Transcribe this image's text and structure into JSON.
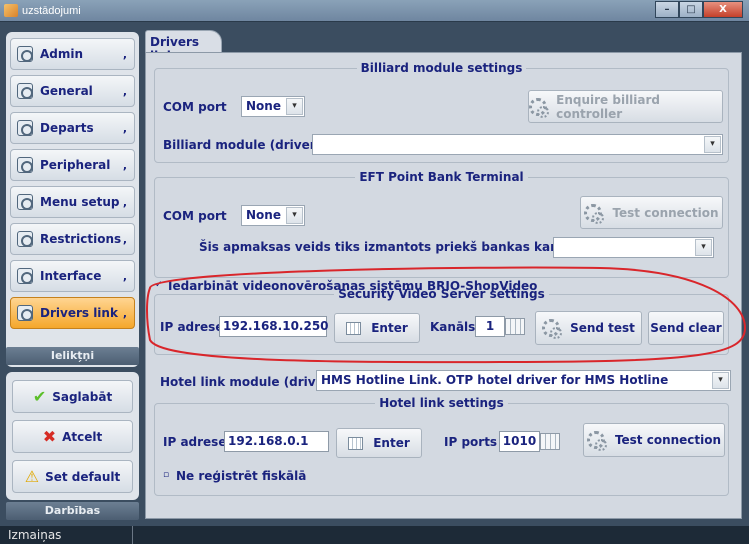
{
  "window": {
    "title": "uzstādojumi",
    "min": "–",
    "max": "□",
    "close": "X"
  },
  "sidebar": {
    "items": [
      {
        "label": "Admin",
        "arrow": ","
      },
      {
        "label": "General",
        "arrow": ","
      },
      {
        "label": "Departs",
        "arrow": ","
      },
      {
        "label": "Peripheral",
        "arrow": ","
      },
      {
        "label": "Menu setup",
        "arrow": ","
      },
      {
        "label": "Restrictions",
        "arrow": ","
      },
      {
        "label": "Interface",
        "arrow": ","
      },
      {
        "label": "Drivers link",
        "arrow": ","
      }
    ],
    "section_settings": "Ielikt̗ņi",
    "actions": [
      {
        "label": "Saglabāt",
        "icon": "check-icon"
      },
      {
        "label": "Atcelt",
        "icon": "cross-icon"
      },
      {
        "label": "Set default",
        "icon": "warning-icon"
      }
    ],
    "section_actions": "Darbības"
  },
  "status": {
    "text": "Izmaiņas"
  },
  "tab": {
    "label": "Drivers link"
  },
  "billiard": {
    "legend": "Billiard module settings",
    "com_label": "COM port",
    "com_value": "None",
    "enquire_button": "Enquire billiard controller",
    "driver_label": "Billiard module (driver)",
    "driver_value": ""
  },
  "eft": {
    "legend": "EFT Point Bank Terminal",
    "com_label": "COM port",
    "com_value": "None",
    "test_button": "Test connection",
    "card_label": "Šis apmaksas veids tiks izmantots priekš bankas kartēm",
    "card_value": ""
  },
  "video": {
    "enable_label": "Iedarbināt videonovērošanas sistēmu BRIO-ShopVideo",
    "enable_checked": "✓",
    "legend": "Security Video Server settings",
    "ip_label": "IP adrese",
    "ip_value": "192.168.10.250",
    "enter_button": "Enter",
    "channel_label": "Kanāls",
    "channel_value": "1",
    "send_test": "Send test",
    "send_clear": "Send clear"
  },
  "hotel": {
    "module_label": "Hotel link module (driver)",
    "module_value": "HMS Hotline Link. OTP hotel driver for HMS Hotline",
    "legend": "Hotel link settings",
    "ip_label": "IP adrese",
    "ip_value": "192.168.0.1",
    "enter_button": "Enter",
    "port_label": "IP ports",
    "port_value": "1010",
    "test_button": "Test connection",
    "fiscal_label": "Ne reģistrēt fiskālā",
    "fiscal_checked": "▫"
  },
  "colors": {
    "accent": "#f5a72b",
    "annotation": "#d9262b",
    "text": "#1a237e"
  }
}
